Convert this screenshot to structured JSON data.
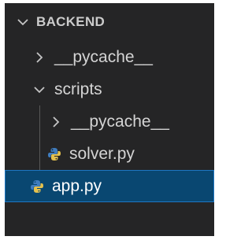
{
  "explorer": {
    "section_title": "BACKEND",
    "items": [
      {
        "label": "__pycache__",
        "type": "folder",
        "expanded": false,
        "depth": 1
      },
      {
        "label": "scripts",
        "type": "folder",
        "expanded": true,
        "depth": 1
      },
      {
        "label": "__pycache__",
        "type": "folder",
        "expanded": false,
        "depth": 2
      },
      {
        "label": "solver.py",
        "type": "file",
        "icon": "python-icon",
        "depth": 2
      },
      {
        "label": "app.py",
        "type": "file",
        "icon": "python-icon",
        "depth": 1,
        "selected": true
      }
    ]
  },
  "colors": {
    "background": "#252526",
    "selection": "#094771",
    "focus_border": "#1e76c2",
    "text": "#d4d4d4",
    "python_blue": "#3f7dbf",
    "python_yellow": "#e5c14e"
  }
}
